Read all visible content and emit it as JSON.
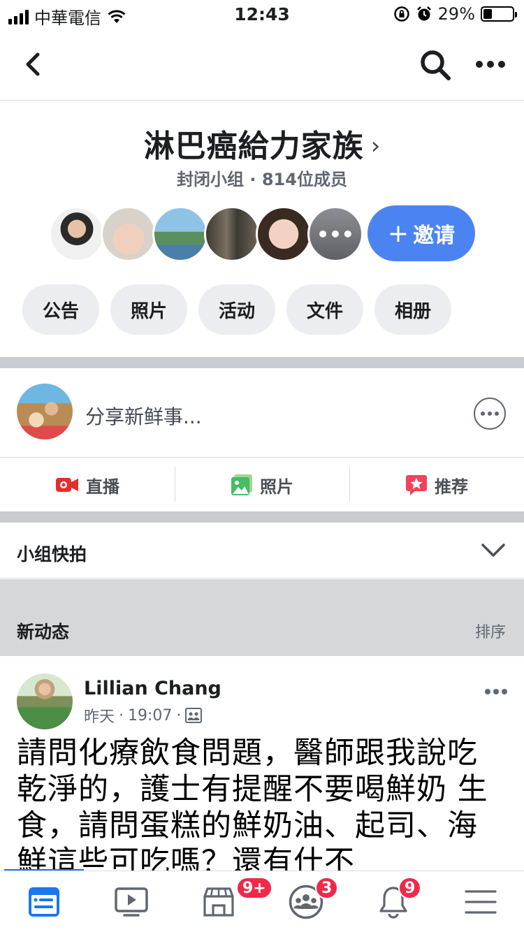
{
  "status_bar": {
    "carrier": "中華電信",
    "time": "12:43",
    "battery": "29%",
    "battery_level": 0.29
  },
  "group": {
    "title": "淋巴癌給力家族",
    "meta": "封闭小组 · 814位成员",
    "invite_label": "邀请",
    "chips": [
      "公告",
      "照片",
      "活动",
      "文件",
      "相册"
    ]
  },
  "composer": {
    "placeholder": "分享新鲜事...",
    "actions": [
      "直播",
      "照片",
      "推荐"
    ]
  },
  "snapshot": {
    "title": "小组快拍"
  },
  "feed": {
    "title": "新动态",
    "sort_label": "排序"
  },
  "post": {
    "author": "Lillian Chang",
    "day": "昨天",
    "time": "19:07",
    "text": "請問化療飲食問題，醫師跟我說吃乾淨的，護士有提醒不要喝鮮奶 生食，請問蛋糕的鮮奶油、起司、海鮮這些可吃嗎？還有什不"
  },
  "tab_bar": {
    "badges": {
      "marketplace": "9+",
      "groups": "3",
      "notifications": "9"
    }
  },
  "colors": {
    "accent": "#1877f2",
    "invite": "#4b84f0",
    "badge": "#f02849"
  }
}
